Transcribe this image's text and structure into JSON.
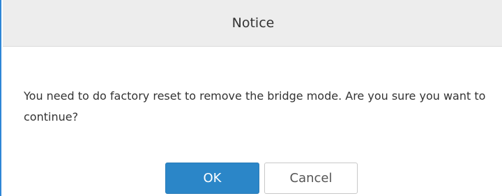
{
  "dialog": {
    "title": "Notice",
    "message": "You need to do factory reset to remove the bridge mode. Are you sure you want to continue?",
    "buttons": {
      "ok_label": "OK",
      "cancel_label": "Cancel"
    }
  },
  "colors": {
    "header_background": "#ededed",
    "primary_button": "#2b86c8",
    "accent_border": "#2f86d6"
  }
}
